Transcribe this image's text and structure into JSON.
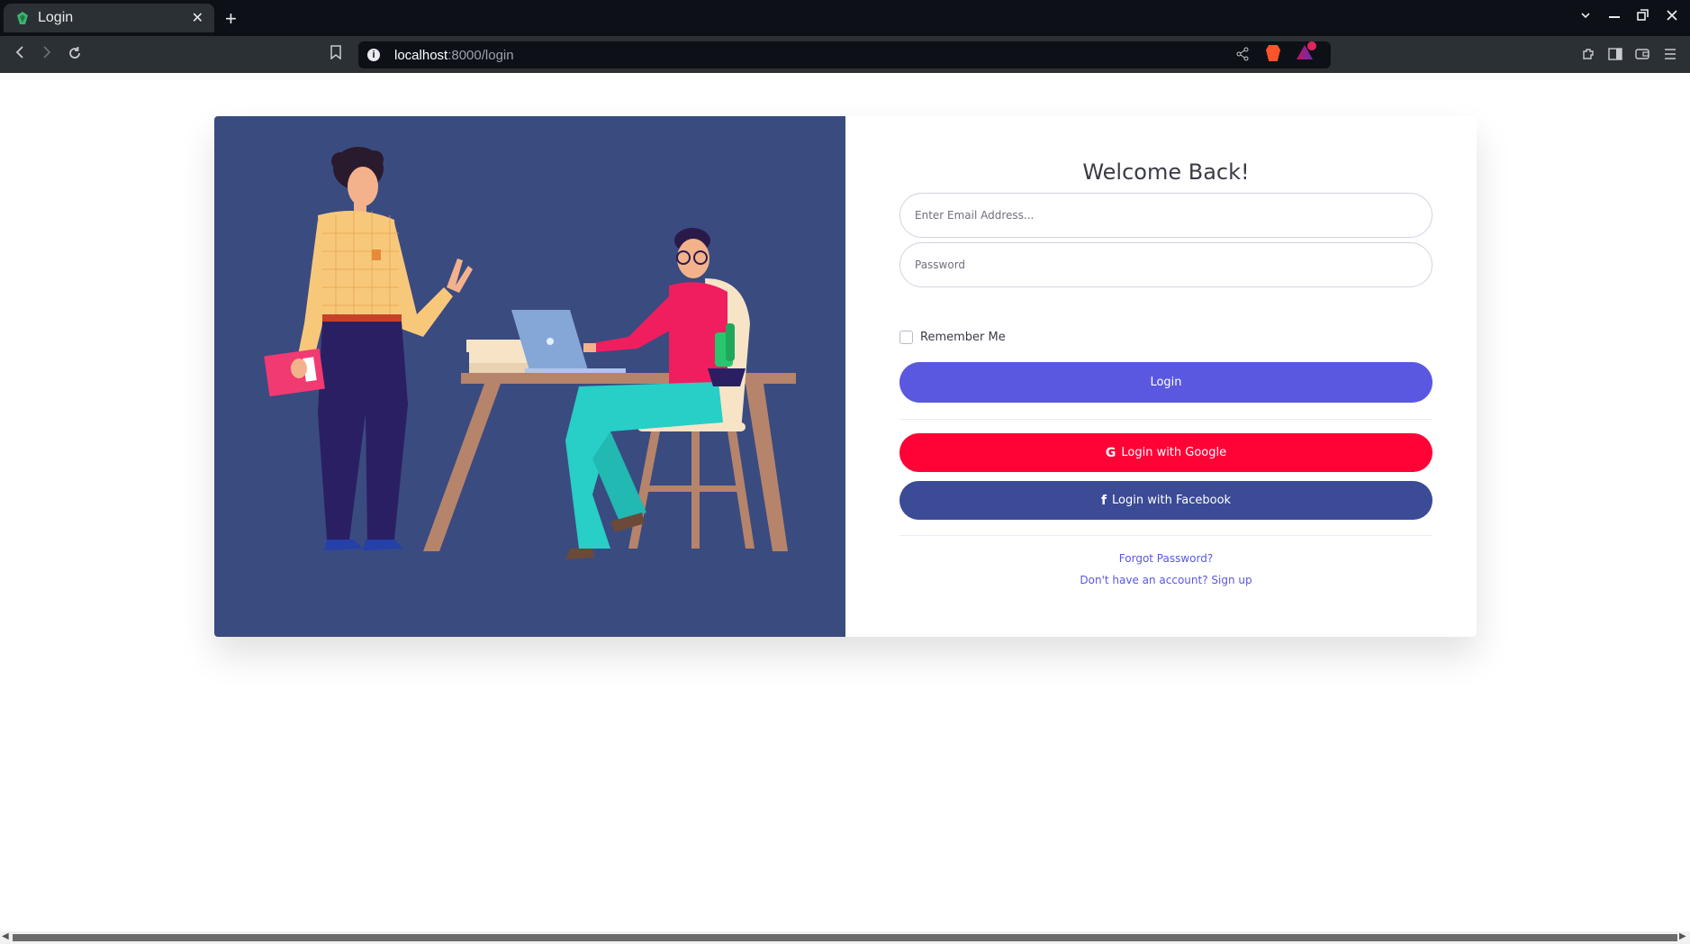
{
  "browser": {
    "tab_title": "Login",
    "tab_close": "✕",
    "new_tab": "+",
    "url_host": "localhost",
    "url_path": ":8000/login"
  },
  "page": {
    "heading": "Welcome Back!",
    "email_placeholder": "Enter Email Address...",
    "password_placeholder": "Password",
    "remember_label": "Remember Me",
    "login_button": "Login",
    "google_button": "Login with Google",
    "facebook_button": "Login with Facebook",
    "forgot_link": "Forgot Password?",
    "signup_link": "Don't have an account? Sign up"
  },
  "colors": {
    "illustration_bg": "#3a4b80",
    "primary": "#5a57e0",
    "google": "#ff0337",
    "facebook": "#3b4b95"
  }
}
